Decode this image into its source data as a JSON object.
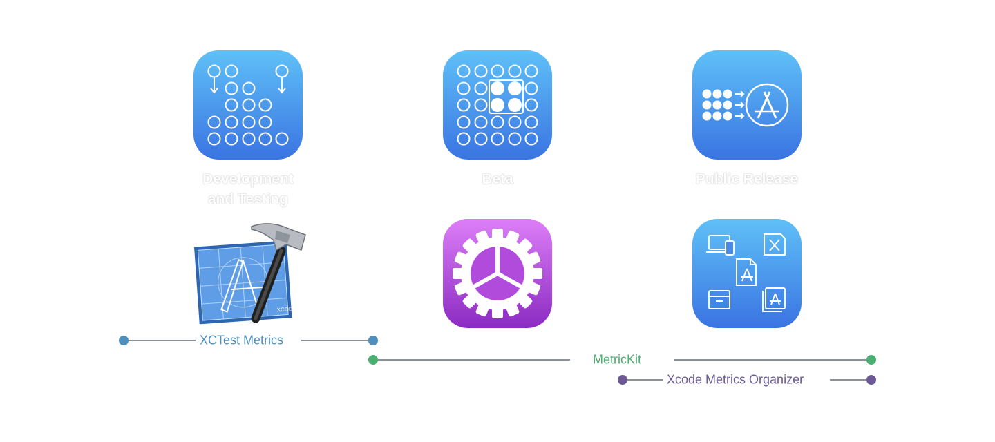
{
  "phases": {
    "development": "Development\nand Testing",
    "beta": "Beta",
    "public": "Public Release"
  },
  "tools": {
    "xcode": "XCODE"
  },
  "tracks": {
    "xctest": {
      "label": "XCTest Metrics",
      "color": "#4e8fbe"
    },
    "metrickit": {
      "label": "MetricKit",
      "color": "#4caf72"
    },
    "organizer": {
      "label": "Xcode Metrics Organizer",
      "color": "#6b5a96"
    }
  },
  "colors": {
    "icon_blue_top": "#5fc0f7",
    "icon_blue_bottom": "#3a74e2",
    "icon_purple_top": "#dd7ef8",
    "icon_purple_bottom": "#8b2bc2",
    "line_gray": "#8a9199"
  }
}
